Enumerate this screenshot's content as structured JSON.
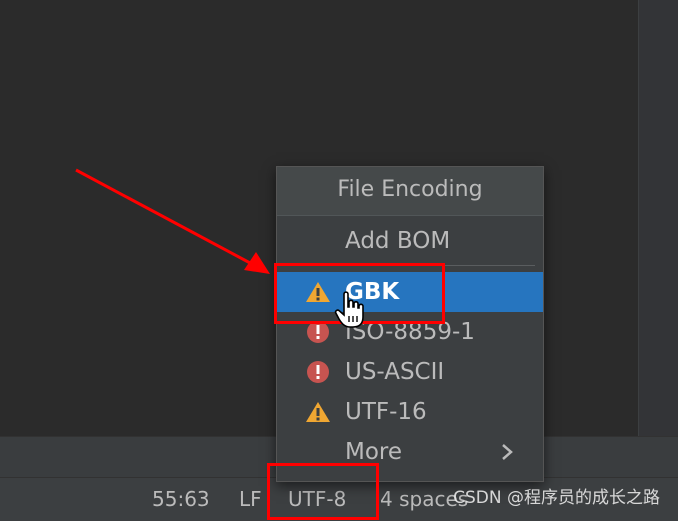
{
  "popup": {
    "title": "File Encoding",
    "add_bom_label": "Add BOM",
    "items": [
      {
        "label": "GBK",
        "icon": "warning-icon",
        "selected": true
      },
      {
        "label": "ISO-8859-1",
        "icon": "error-icon",
        "selected": false
      },
      {
        "label": "US-ASCII",
        "icon": "error-icon",
        "selected": false
      },
      {
        "label": "UTF-16",
        "icon": "warning-icon",
        "selected": false
      }
    ],
    "more_label": "More"
  },
  "statusbar": {
    "position": "55:63",
    "line_separator": "LF",
    "encoding": "UTF-8",
    "indent": "4 spaces"
  },
  "watermark": "CSDN @程序员的成长之路",
  "colors": {
    "selection": "#2675bf",
    "warning": "#f0a732",
    "error": "#c75450",
    "annotation": "#ff0000"
  }
}
